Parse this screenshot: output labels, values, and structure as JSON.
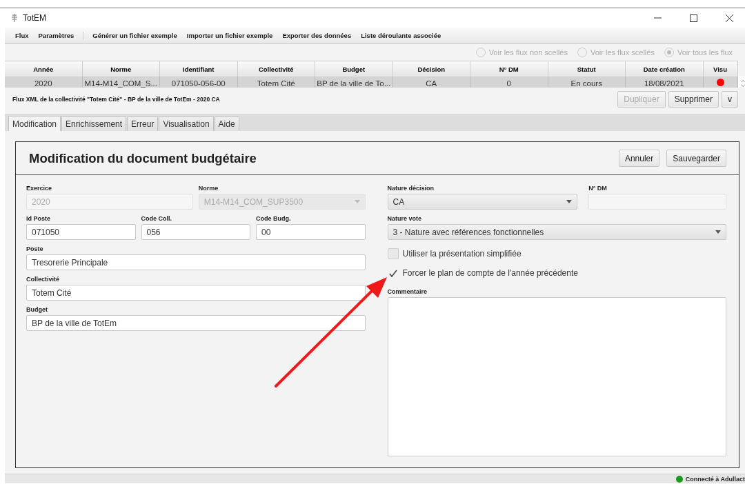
{
  "window": {
    "title": "TotEM"
  },
  "menu": [
    "Flux",
    "Paramètres",
    "Générer un fichier exemple",
    "Importer un fichier exemple",
    "Exporter des données",
    "Liste déroulante associée"
  ],
  "filters": [
    {
      "label": "Voir les flux non scellés",
      "selected": false,
      "disabled": true
    },
    {
      "label": "Voir les flux scellés",
      "selected": false,
      "disabled": true
    },
    {
      "label": "Voir tous les flux",
      "selected": true,
      "disabled": true
    }
  ],
  "table": {
    "columns": [
      "Année",
      "Norme",
      "Identifiant",
      "Collectivité",
      "Budget",
      "Décision",
      "N° DM",
      "Statut",
      "Date création",
      "Visu"
    ],
    "rows": [
      {
        "cells": [
          "2020",
          "M14-M14_COM_S...",
          "071050-056-00",
          "Totem Cité",
          "BP de la ville de To...",
          "CA",
          "0",
          "En cours",
          "18/08/2021"
        ],
        "color": "#ff0000",
        "selected": true
      }
    ]
  },
  "info": "Flux XML de la collectivité \"Totem Cité\" - BP de la ville de TotEm - 2020 CA",
  "actions": [
    {
      "label": "Dupliquer",
      "disabled": true
    },
    {
      "label": "Supprimer",
      "disabled": false
    },
    {
      "label": "v",
      "disabled": false
    }
  ],
  "tabs": [
    {
      "label": "Modification",
      "selected": true
    },
    {
      "label": "Enrichissement",
      "selected": false
    },
    {
      "label": "Erreur",
      "selected": false
    },
    {
      "label": "Visualisation",
      "selected": false
    },
    {
      "label": "Aide",
      "selected": false
    }
  ],
  "form": {
    "title": "Modification du document budgétaire",
    "buttons": [
      "Annuler",
      "Sauvegarder"
    ],
    "left_rows": [
      [
        {
          "kind": "input",
          "label": "Exercice",
          "value": "2020",
          "disabled": true
        },
        {
          "kind": "select",
          "label": "Norme",
          "value": "M14-M14_COM_SUP3500",
          "disabled": true
        }
      ],
      [
        {
          "kind": "input",
          "label": "Id Poste",
          "value": "071050",
          "disabled": false
        },
        {
          "kind": "input",
          "label": "Code Coll.",
          "value": "056",
          "disabled": false
        },
        {
          "kind": "input",
          "label": "Code Budg.",
          "value": "00",
          "disabled": false
        }
      ],
      [
        {
          "kind": "input",
          "label": "Poste",
          "value": "Tresorerie Principale",
          "disabled": false
        }
      ],
      [
        {
          "kind": "input",
          "label": "Collectivité",
          "value": "Totem Cité",
          "disabled": false
        }
      ],
      [
        {
          "kind": "input",
          "label": "Budget",
          "value": "BP de la ville de TotEm",
          "disabled": false
        }
      ]
    ],
    "right_rows": [
      [
        {
          "kind": "select",
          "label": "Nature décision",
          "value": "CA",
          "disabled": false
        },
        {
          "kind": "input",
          "label": "N° DM",
          "disabled": true
        }
      ],
      [
        {
          "kind": "select",
          "label": "Nature vote",
          "value": "3 - Nature avec références fonctionnelles",
          "disabled": false
        }
      ]
    ],
    "checkboxes": [
      {
        "label": "Utiliser la présentation simplifiée",
        "checked": false
      },
      {
        "label": "Forcer le plan de compte de l'année précédente",
        "checked": true
      }
    ],
    "comment": {
      "label": "Commentaire"
    }
  },
  "status": {
    "text": "Connecté à Adullact",
    "color": "#1a9a1a"
  }
}
